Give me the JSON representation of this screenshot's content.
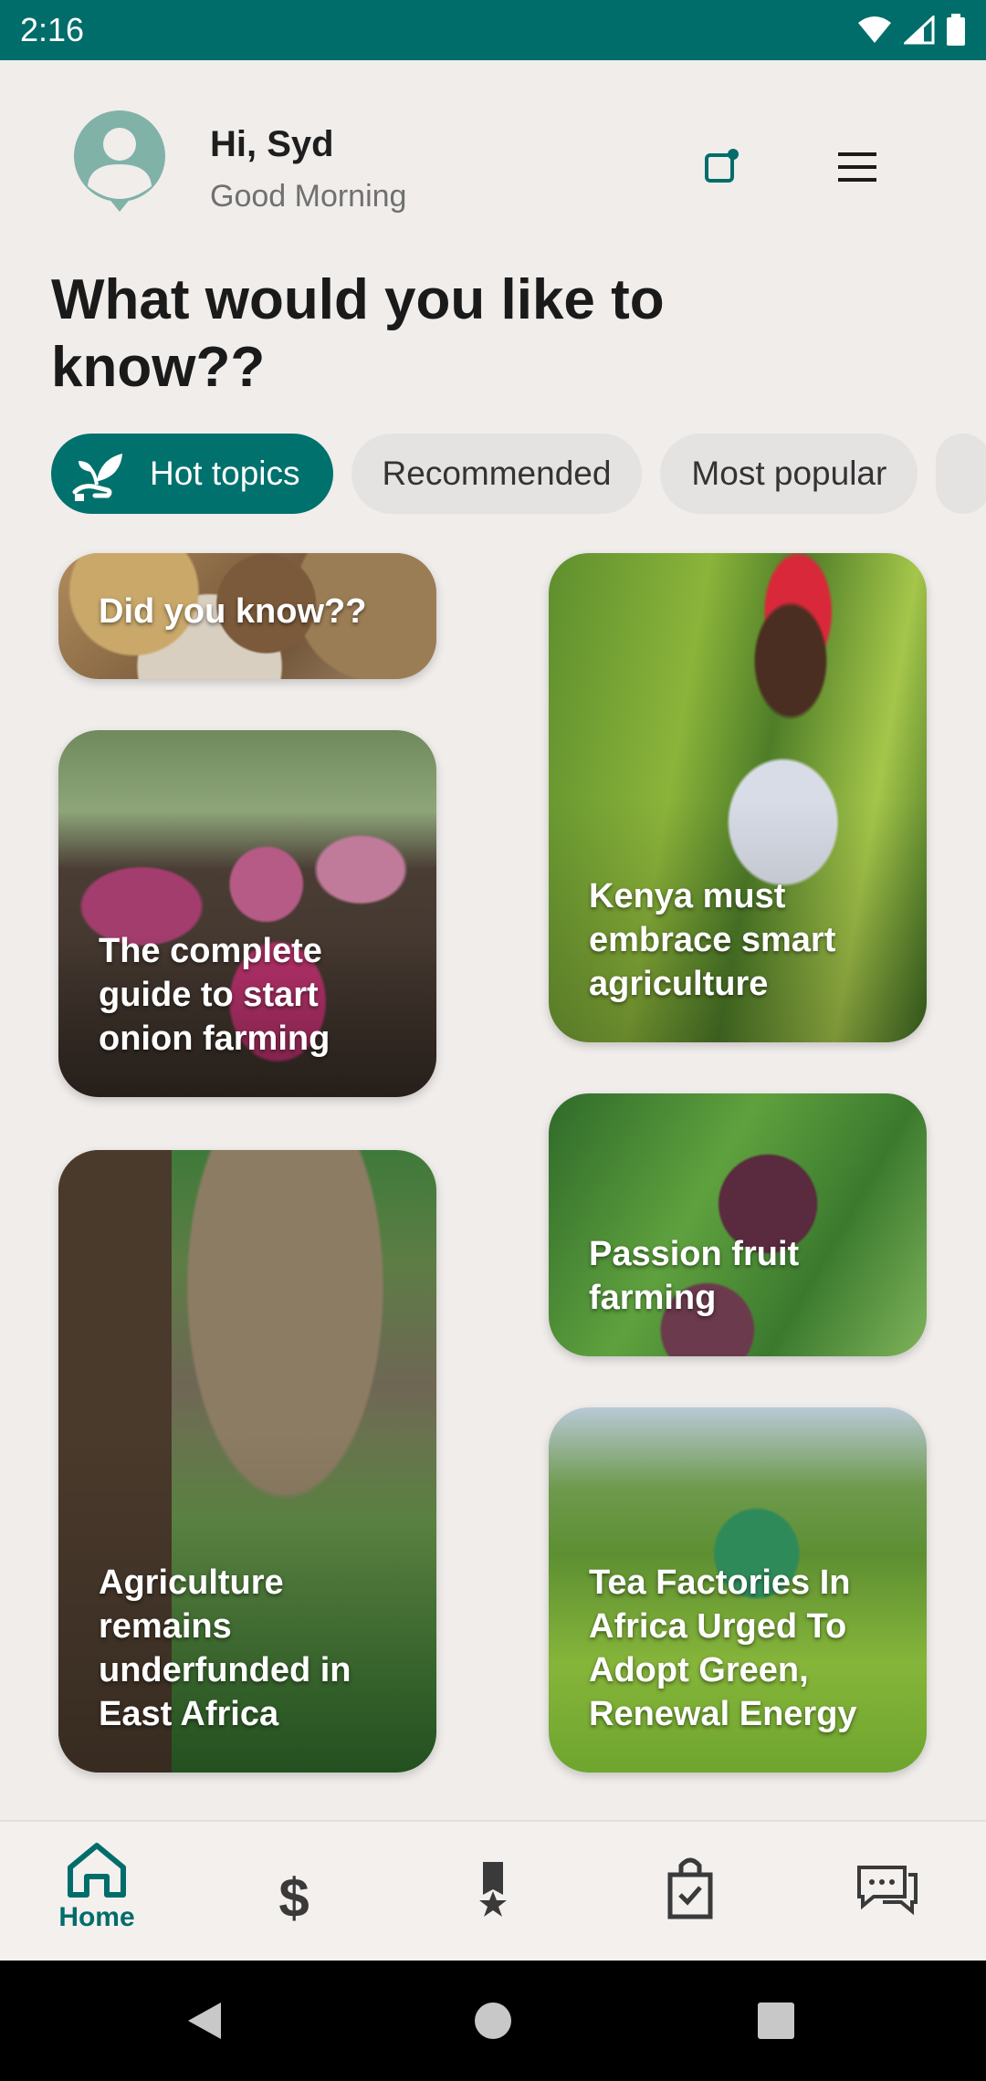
{
  "status_bar": {
    "time": "2:16"
  },
  "header": {
    "greeting": "Hi, Syd",
    "subtitle": "Good Morning"
  },
  "headline": "What would you like to know??",
  "chips": [
    {
      "label": "Hot topics",
      "active": true
    },
    {
      "label": "Recommended",
      "active": false
    },
    {
      "label": "Most popular",
      "active": false
    }
  ],
  "cards": {
    "did_you_know": "Did you know??",
    "onion": "The complete guide to start onion farming",
    "agri_underfunded": "Agriculture remains underfunded in East Africa",
    "kenya": "Kenya must embrace smart agriculture",
    "passion": "Passion fruit farming",
    "tea": "Tea Factories In Africa Urged To Adopt Green, Renewal Energy"
  },
  "bottom_nav": {
    "home": "Home",
    "money_icon": "dollar-icon",
    "medal_icon": "medal-icon",
    "bag_icon": "shopping-bag-icon",
    "chat_icon": "chat-icon"
  },
  "colors": {
    "brand": "#006d6b",
    "chip_inactive": "#e5e3e2",
    "background": "#f0edeb"
  }
}
